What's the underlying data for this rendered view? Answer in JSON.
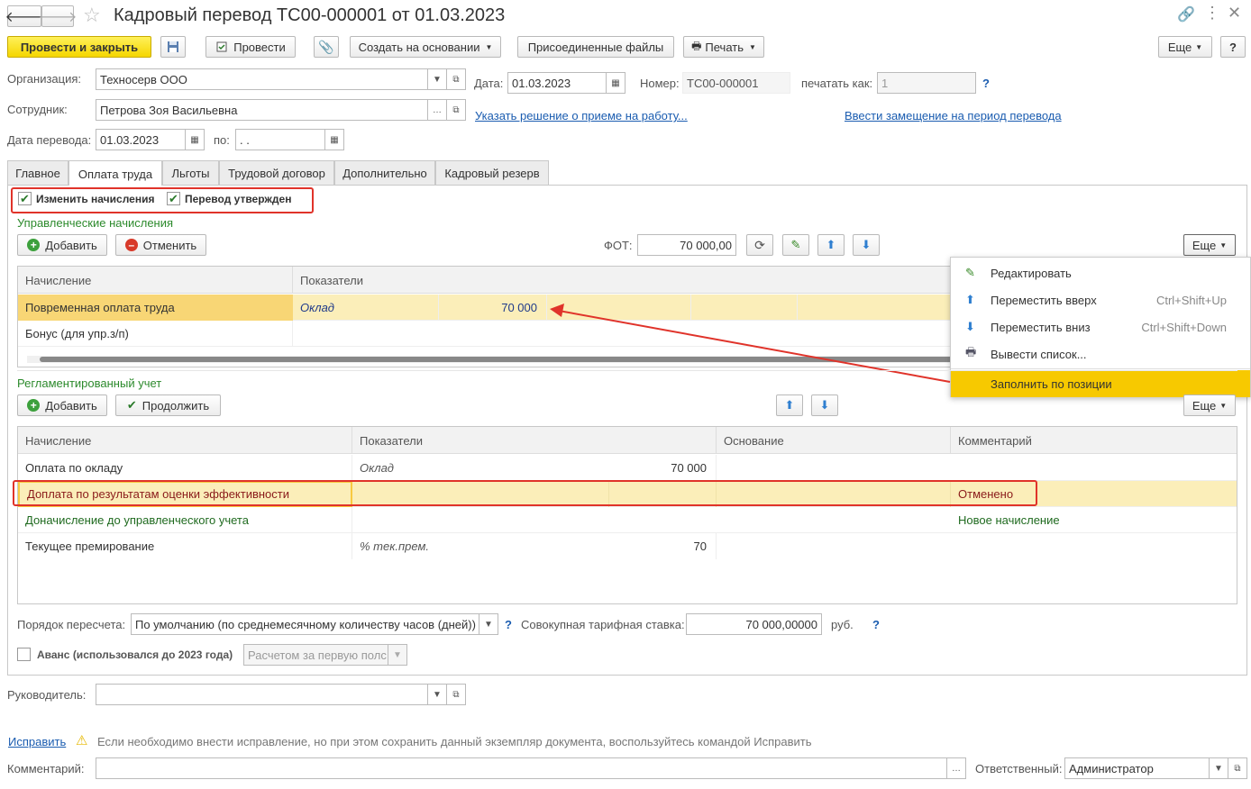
{
  "window": {
    "title": "Кадровый перевод ТС00-000001 от 01.03.2023"
  },
  "toolbar": {
    "post_close": "Провести и закрыть",
    "post": "Провести",
    "create_based": "Создать на основании",
    "attached_files": "Присоединенные файлы",
    "print": "Печать",
    "more": "Еще",
    "help": "?"
  },
  "header": {
    "org_label": "Организация:",
    "org_value": "Техносерв ООО",
    "date_label": "Дата:",
    "date_value": "01.03.2023",
    "number_label": "Номер:",
    "number_value": "ТС00-000001",
    "print_as_label": "печатать как:",
    "print_as_value": "1",
    "help": "?",
    "employee_label": "Сотрудник:",
    "employee_value": "Петрова Зоя Васильевна",
    "hire_link": "Указать решение о приеме на работу...",
    "replace_link": "Ввести замещение на период перевода",
    "transfer_date_label": "Дата перевода:",
    "transfer_date_value": "01.03.2023",
    "to_label": "по:",
    "to_value": " .  ."
  },
  "tabs": [
    "Главное",
    "Оплата труда",
    "Льготы",
    "Трудовой договор",
    "Дополнительно",
    "Кадровый резерв"
  ],
  "checks": {
    "change_accruals": "Изменить начисления",
    "approved": "Перевод утвержден"
  },
  "mgmt": {
    "title": "Управленческие начисления",
    "add": "Добавить",
    "cancel": "Отменить",
    "fot_label": "ФОТ:",
    "fot_value": "70 000,00",
    "more": "Еще",
    "col_accrual": "Начисление",
    "col_indicators": "Показатели",
    "rows": [
      {
        "name": "Повременная оплата труда",
        "indicator": "Оклад",
        "value": "70 000"
      },
      {
        "name": "Бонус (для упр.з/п)",
        "indicator": "",
        "value": ""
      }
    ]
  },
  "context_menu": {
    "items": [
      {
        "label": "Редактировать",
        "shortcut": ""
      },
      {
        "label": "Переместить вверх",
        "shortcut": "Ctrl+Shift+Up"
      },
      {
        "label": "Переместить вниз",
        "shortcut": "Ctrl+Shift+Down"
      },
      {
        "label": "Вывести список...",
        "shortcut": ""
      },
      {
        "label": "Заполнить по позиции",
        "shortcut": ""
      }
    ]
  },
  "reg": {
    "title": "Регламентированный учет",
    "add": "Добавить",
    "continue": "Продолжить",
    "more": "Еще",
    "col_accrual": "Начисление",
    "col_indicators": "Показатели",
    "col_basis": "Основание",
    "col_comment": "Комментарий",
    "rows": [
      {
        "name": "Оплата по окладу",
        "indicator": "Оклад",
        "value": "70 000",
        "comment": ""
      },
      {
        "name": "Доплата по результатам оценки эффективности",
        "indicator": "",
        "value": "",
        "comment": "Отменено"
      },
      {
        "name": "Доначисление до управленческого учета",
        "indicator": "",
        "value": "",
        "comment": "Новое начисление"
      },
      {
        "name": "Текущее премирование",
        "indicator": "% тек.прем.",
        "value": "70",
        "comment": ""
      }
    ]
  },
  "bottom": {
    "recalc_label": "Порядок пересчета:",
    "recalc_value": "По умолчанию (по среднемесячному количеству часов (дней))",
    "total_rate_label": "Совокупная тарифная ставка:",
    "total_rate_value": "70 000,00000",
    "currency": "руб.",
    "advance_label": "Аванс (использовался до 2023 года)",
    "advance_value": "Расчетом за первую полс",
    "manager_label": "Руководитель:",
    "fix_link": "Исправить",
    "fix_note": "Если необходимо внести исправление, но при этом сохранить данный экземпляр документа, воспользуйтесь командой Исправить",
    "comment_label": "Комментарий:",
    "responsible_label": "Ответственный:",
    "responsible_value": "Администратор"
  },
  "colors": {
    "accent_yellow": "#f5d600",
    "selected_row": "#fbe9a6",
    "annotation_red": "#e0332a",
    "link_blue": "#1a5cb0",
    "section_green": "#2c8a2c"
  }
}
